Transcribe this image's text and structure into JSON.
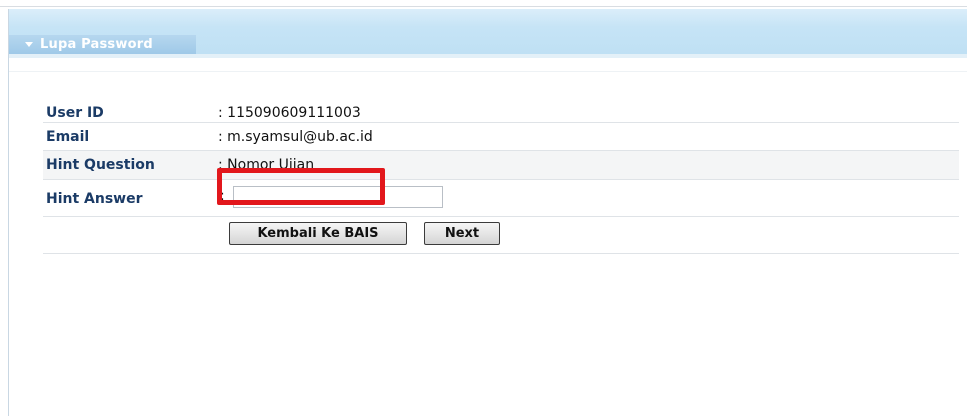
{
  "panel": {
    "title": "Lupa Password",
    "header_color": "#c6e4f6",
    "tab_color": "#a9d0ec"
  },
  "form": {
    "user_id": {
      "label": "User ID",
      "value": ": 115090609111003"
    },
    "email": {
      "label": "Email",
      "value": ": m.syamsul@ub.ac.id"
    },
    "hint_question": {
      "label": "Hint Question",
      "value": ": Nomor Ujian"
    },
    "hint_answer": {
      "label": "Hint Answer",
      "colon": ":",
      "value": "",
      "placeholder": ""
    }
  },
  "buttons": {
    "back_label": "Kembali Ke BAIS",
    "next_label": "Next"
  },
  "annotation": {
    "highlight_color": "#e2171c"
  }
}
